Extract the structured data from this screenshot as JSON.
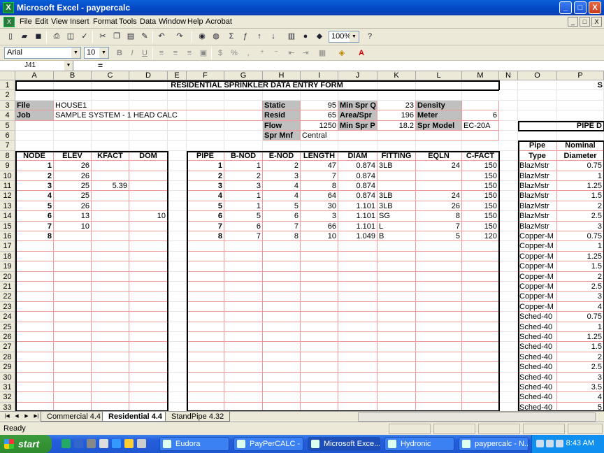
{
  "window": {
    "title": "Microsoft Excel - paypercalc",
    "min": "_",
    "max": "□",
    "close": "X"
  },
  "menu": [
    "File",
    "Edit",
    "View",
    "Insert",
    "Format",
    "Tools",
    "Data",
    "Window",
    "Help",
    "Acrobat"
  ],
  "menu_doc_buttons": [
    "_",
    "□",
    "X"
  ],
  "toolbar": {
    "zoom": "100%"
  },
  "format_toolbar": {
    "font": "Arial",
    "size": "10"
  },
  "formula_bar": {
    "namebox": "J41",
    "eq": "="
  },
  "columns": [
    "A",
    "B",
    "C",
    "D",
    "E",
    "F",
    "G",
    "H",
    "I",
    "J",
    "K",
    "L",
    "M",
    "N",
    "O",
    "P"
  ],
  "rows": [
    "1",
    "2",
    "3",
    "4",
    "5",
    "6",
    "7",
    "8",
    "9",
    "10",
    "11",
    "12",
    "13",
    "14",
    "15",
    "16",
    "17",
    "18",
    "19",
    "20",
    "21",
    "22",
    "23",
    "24",
    "25",
    "26",
    "27",
    "28",
    "29",
    "30",
    "31",
    "32",
    "33"
  ],
  "sheet": {
    "title": "RESIDENTIAL SPRINKLER DATA ENTRY FORM",
    "right_title": "S",
    "pipe_d_title": "PIPE D",
    "file_label": "File",
    "file_value": "HOUSE1",
    "job_label": "Job",
    "job_value": "SAMPLE SYSTEM - 1 HEAD CALC",
    "params": [
      {
        "label": "Static",
        "value": "95",
        "label2": "Min Spr Q",
        "value2": "23",
        "label3": "Density",
        "value3": ""
      },
      {
        "label": "Resid",
        "value": "65",
        "label2": "Area/Spr",
        "value2": "196",
        "label3": "Meter",
        "value3": "6"
      },
      {
        "label": "Flow",
        "value": "1250",
        "label2": "Min Spr P",
        "value2": "18.2",
        "label3": "Spr Model",
        "value3": "EC-20A"
      }
    ],
    "spr_mnf_label": "Spr Mnf",
    "spr_mnf_value": "Central",
    "node_headers": [
      "NODE",
      "ELEV",
      "KFACT",
      "DOM"
    ],
    "nodes": [
      [
        "1",
        "26",
        "",
        ""
      ],
      [
        "2",
        "26",
        "",
        ""
      ],
      [
        "3",
        "25",
        "5.39",
        ""
      ],
      [
        "4",
        "25",
        "",
        ""
      ],
      [
        "5",
        "26",
        "",
        ""
      ],
      [
        "6",
        "13",
        "",
        "10"
      ],
      [
        "7",
        "10",
        "",
        ""
      ],
      [
        "8",
        "",
        "",
        ""
      ]
    ],
    "pipe_headers": [
      "PIPE",
      "B-NOD",
      "E-NOD",
      "LENGTH",
      "DIAM",
      "FITTING",
      "EQLN",
      "C-FACT"
    ],
    "pipes": [
      [
        "1",
        "1",
        "2",
        "47",
        "0.874",
        "3LB",
        "24",
        "150"
      ],
      [
        "2",
        "2",
        "3",
        "7",
        "0.874",
        "",
        "",
        "150"
      ],
      [
        "3",
        "3",
        "4",
        "8",
        "0.874",
        "",
        "",
        "150"
      ],
      [
        "4",
        "1",
        "4",
        "64",
        "0.874",
        "3LB",
        "24",
        "150"
      ],
      [
        "5",
        "1",
        "5",
        "30",
        "1.101",
        "3LB",
        "26",
        "150"
      ],
      [
        "6",
        "5",
        "6",
        "3",
        "1.101",
        "SG",
        "8",
        "150"
      ],
      [
        "7",
        "6",
        "7",
        "66",
        "1.101",
        "L",
        "7",
        "150"
      ],
      [
        "8",
        "7",
        "8",
        "10",
        "1.049",
        "B",
        "5",
        "120"
      ]
    ],
    "pipe_table_headers": [
      [
        "Pipe",
        "Nominal"
      ],
      [
        "Type",
        "Diameter"
      ]
    ],
    "pipe_table": [
      [
        "BlazMstr",
        "0.75"
      ],
      [
        "BlazMstr",
        "1"
      ],
      [
        "BlazMstr",
        "1.25"
      ],
      [
        "BlazMstr",
        "1.5"
      ],
      [
        "BlazMstr",
        "2"
      ],
      [
        "BlazMstr",
        "2.5"
      ],
      [
        "BlazMstr",
        "3"
      ],
      [
        "Copper-M",
        "0.75"
      ],
      [
        "Copper-M",
        "1"
      ],
      [
        "Copper-M",
        "1.25"
      ],
      [
        "Copper-M",
        "1.5"
      ],
      [
        "Copper-M",
        "2"
      ],
      [
        "Copper-M",
        "2.5"
      ],
      [
        "Copper-M",
        "3"
      ],
      [
        "Copper-M",
        "4"
      ],
      [
        "Sched-40",
        "0.75"
      ],
      [
        "Sched-40",
        "1"
      ],
      [
        "Sched-40",
        "1.25"
      ],
      [
        "Sched-40",
        "1.5"
      ],
      [
        "Sched-40",
        "2"
      ],
      [
        "Sched-40",
        "2.5"
      ],
      [
        "Sched-40",
        "3"
      ],
      [
        "Sched-40",
        "3.5"
      ],
      [
        "Sched-40",
        "4"
      ],
      [
        "Sched-40",
        "5"
      ]
    ]
  },
  "tabs": [
    "Commercial 4.4",
    "Residential 4.4",
    "StandPipe 4.32"
  ],
  "status": "Ready",
  "taskbar": {
    "start": "start",
    "tasks": [
      "Eudora",
      "PayPerCALC - ...",
      "Microsoft Exce...",
      "Hydronic",
      "paypercalc - N..."
    ],
    "clock": "8:43 AM"
  }
}
